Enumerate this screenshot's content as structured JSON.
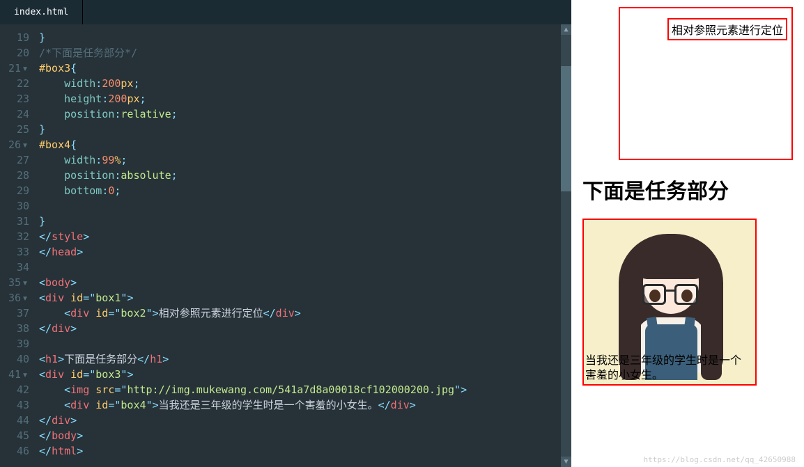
{
  "tab": {
    "filename": "index.html"
  },
  "gutter": {
    "start": 19,
    "end": 46
  },
  "code": {
    "l19": {
      "brace": "}"
    },
    "l20": {
      "comment": "/*下面是任务部分*/"
    },
    "l21": {
      "sel": "#box3",
      "brace": "{"
    },
    "l22": {
      "prop": "width",
      "val": "200",
      "unit": "px"
    },
    "l23": {
      "prop": "height",
      "val": "200",
      "unit": "px"
    },
    "l24": {
      "prop": "position",
      "val": "relative"
    },
    "l25": {
      "brace": "}"
    },
    "l26": {
      "sel": "#box4",
      "brace": "{"
    },
    "l27": {
      "prop": "width",
      "val": "99",
      "unit": "%"
    },
    "l28": {
      "prop": "position",
      "val": "absolute"
    },
    "l29": {
      "prop": "bottom",
      "val": "0"
    },
    "l31": {
      "brace": "}"
    },
    "l32": {
      "ctag": "style"
    },
    "l33": {
      "ctag": "head"
    },
    "l35": {
      "otag": "body"
    },
    "l36": {
      "otag": "div",
      "attr": "id",
      "attrval": "box1"
    },
    "l37": {
      "otag": "div",
      "attr": "id",
      "attrval": "box2",
      "text": "相对参照元素进行定位",
      "ctag": "div"
    },
    "l38": {
      "ctag": "div"
    },
    "l40": {
      "otag": "h1",
      "text": "下面是任务部分",
      "ctag": "h1"
    },
    "l41": {
      "otag": "div",
      "attr": "id",
      "attrval": "box3"
    },
    "l42": {
      "otag": "img",
      "attr": "src",
      "attrval": "http://img.mukewang.com/541a7d8a00018cf102000200.jpg"
    },
    "l43": {
      "otag": "div",
      "attr": "id",
      "attrval": "box4",
      "text": "当我还是三年级的学生时是一个害羞的小女生。",
      "ctag": "div"
    },
    "l44": {
      "ctag": "div"
    },
    "l45": {
      "ctag": "body"
    },
    "l46": {
      "ctag": "html"
    }
  },
  "preview": {
    "box2_text": "相对参照元素进行定位",
    "heading": "下面是任务部分",
    "box4_text": "当我还是三年级的学生时是一个害羞的小女生。"
  },
  "watermark": "https://blog.csdn.net/qq_42650988"
}
